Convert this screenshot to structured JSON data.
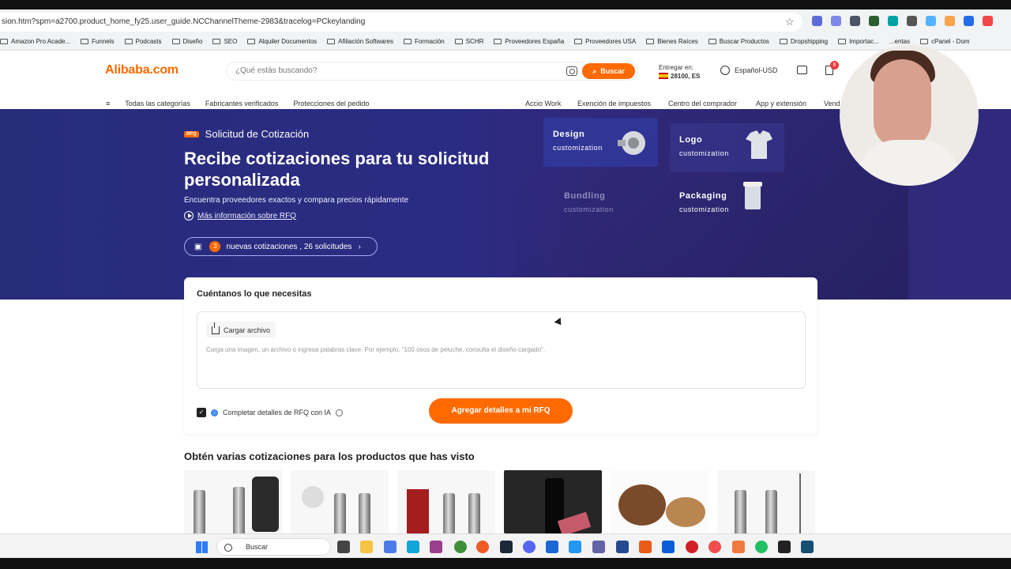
{
  "browser": {
    "url": "sion.htm?spm=a2700.product_home_fy25.user_guide.NCChannelTheme-2983&tracelog=PCkeylanding",
    "bookmarks": [
      "Amazon Pro Acade...",
      "Funnels",
      "Podcasts",
      "Diseño",
      "SEO",
      "Alquiler Documentos",
      "Afiliación Softwares",
      "Formación",
      "SCHR",
      "Proveedores España",
      "Proveedores USA",
      "Bienes Raíces",
      "Buscar Productos",
      "Dropshipping",
      "Importac...",
      "...entas",
      "cPanel - Dom"
    ]
  },
  "header": {
    "logo": "Alibaba.com",
    "search_placeholder": "¿Qué estás buscando?",
    "search_button": "Buscar",
    "deliver_label": "Entregar en:",
    "deliver_value": "28100, ES",
    "language": "Español-USD",
    "cart_count": "8",
    "nav_left": [
      "Todas las categorías",
      "Fabricantes verificados",
      "Protecciones del pedido"
    ],
    "nav_right": [
      "Accio Work",
      "Exención de impuestos",
      "Centro del comprador",
      "App y extensión",
      "Vend"
    ]
  },
  "hero": {
    "badge": "RFQ",
    "tag": "Solicitud de Cotización",
    "title": "Recibe cotizaciones para tu solicitud personalizada",
    "subtitle": "Encuentra proveedores exactos y compara precios rápidamente",
    "link": "Más información sobre RFQ",
    "quote_count": "3",
    "quote_text": "nuevas cotizaciones , 26 solicitudes",
    "cards": [
      {
        "title": "Design",
        "subtitle": "customization"
      },
      {
        "title": "Logo",
        "subtitle": "customization"
      },
      {
        "title": "Bundling",
        "subtitle": "customization"
      },
      {
        "title": "Packaging",
        "subtitle": "customization"
      }
    ]
  },
  "form": {
    "title": "Cuéntanos lo que necesitas",
    "upload": "Cargar archivo",
    "placeholder": "Carga una imagen, un archivo o ingresa palabras clave. Por ejemplo, \"100 osos de peluche, consulta el diseño cargado\".",
    "ai_label": "Completar detalles de RFQ con IA",
    "submit": "Agregar detalles a mi RFQ"
  },
  "products": {
    "title": "Obtén varias cotizaciones para los productos que has visto"
  },
  "taskbar": {
    "search": "Buscar"
  },
  "colors": {
    "accent": "#ff6a00",
    "hero": "#2a2b83",
    "text": "#222222"
  }
}
